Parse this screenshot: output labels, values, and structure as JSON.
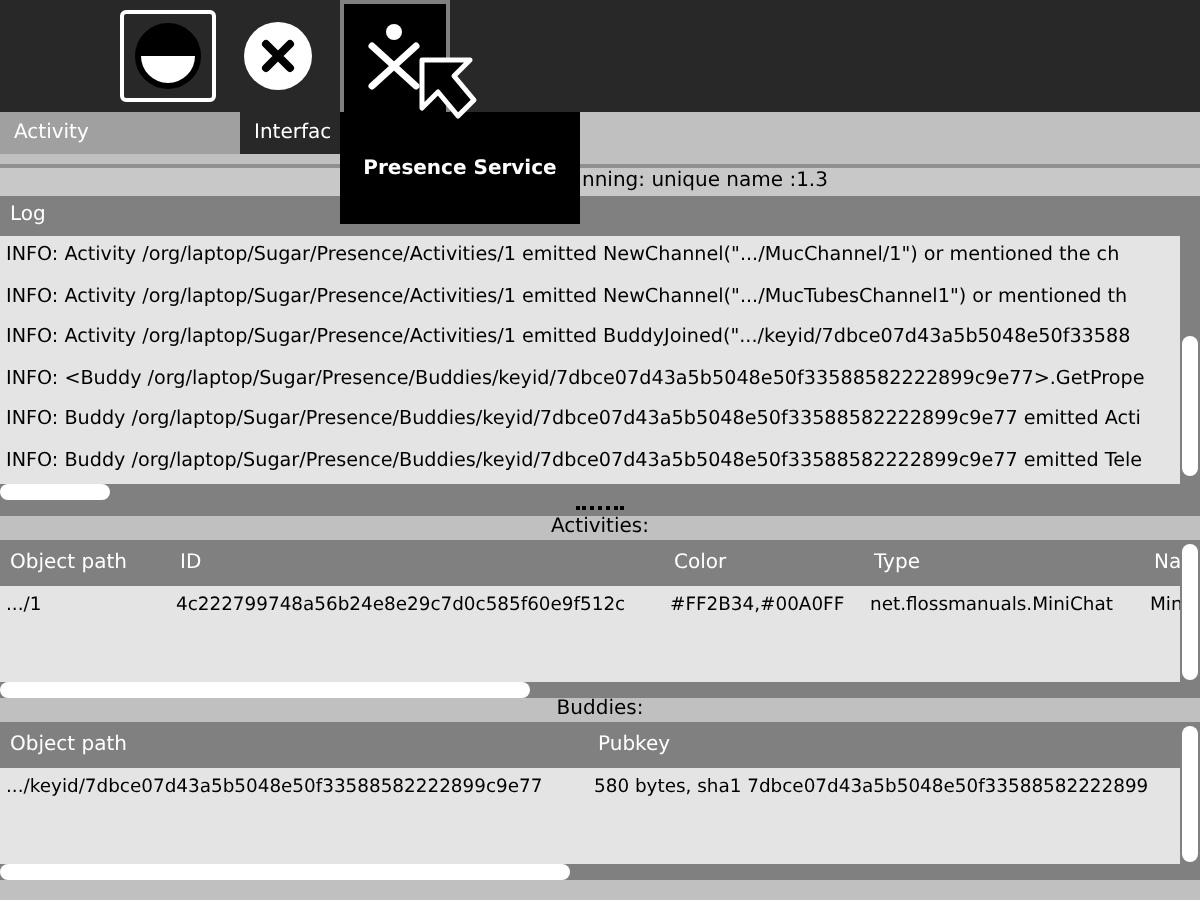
{
  "toolbar": [
    {
      "kind": "activity",
      "selected": true
    },
    {
      "kind": "stop",
      "selected": false
    },
    {
      "kind": "presence",
      "selected": false
    }
  ],
  "palette": {
    "title": "Presence Service"
  },
  "tabs": [
    {
      "label": "Activity",
      "selected": false
    },
    {
      "label": "Interfac",
      "selected": true
    }
  ],
  "status": "nning: unique name :1.3",
  "log": {
    "title": "Log",
    "lines": [
      "INFO: Activity /org/laptop/Sugar/Presence/Activities/1 emitted NewChannel(\".../MucChannel/1\") or mentioned the ch",
      "INFO: Activity /org/laptop/Sugar/Presence/Activities/1 emitted NewChannel(\".../MucTubesChannel1\") or mentioned th",
      "INFO: Activity /org/laptop/Sugar/Presence/Activities/1 emitted BuddyJoined(\".../keyid/7dbce07d43a5b5048e50f33588",
      "INFO: <Buddy /org/laptop/Sugar/Presence/Buddies/keyid/7dbce07d43a5b5048e50f33588582222899c9e77>.GetPrope",
      "INFO: Buddy /org/laptop/Sugar/Presence/Buddies/keyid/7dbce07d43a5b5048e50f33588582222899c9e77 emitted Acti",
      "INFO: Buddy /org/laptop/Sugar/Presence/Buddies/keyid/7dbce07d43a5b5048e50f33588582222899c9e77 emitted Tele"
    ]
  },
  "activities": {
    "title": "Activities:",
    "columns": [
      "Object path",
      "ID",
      "Color",
      "Type",
      "Na"
    ],
    "rows": [
      [
        ".../1",
        "4c222799748a56b24e8e29c7d0c585f60e9f512c",
        "#FF2B34,#00A0FF",
        "net.flossmanuals.MiniChat",
        "Min"
      ]
    ]
  },
  "buddies": {
    "title": "Buddies:",
    "columns": [
      "Object path",
      "Pubkey"
    ],
    "rows": [
      [
        ".../keyid/7dbce07d43a5b5048e50f33588582222899c9e77",
        "580 bytes, sha1 7dbce07d43a5b5048e50f33588582222899"
      ]
    ]
  }
}
